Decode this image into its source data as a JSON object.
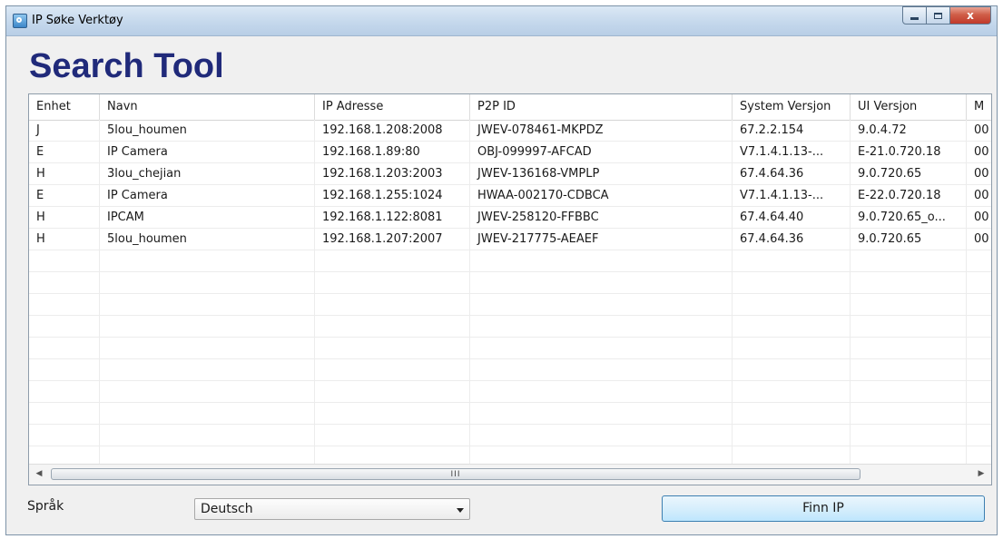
{
  "window": {
    "title": "IP Søke Verktøy",
    "close_glyph": "x"
  },
  "heading": "Search Tool",
  "table": {
    "columns": [
      "Enhet",
      "Navn",
      "IP Adresse",
      "P2P ID",
      "System Versjon",
      "UI Versjon",
      "M"
    ],
    "rows": [
      [
        "J",
        "5lou_houmen",
        "192.168.1.208:2008",
        "JWEV-078461-MKPDZ",
        "67.2.2.154",
        "9.0.4.72",
        "00"
      ],
      [
        "E",
        "IP Camera",
        "192.168.1.89:80",
        "OBJ-099997-AFCAD",
        "V7.1.4.1.13-...",
        "E-21.0.720.18",
        "00"
      ],
      [
        "H",
        "3lou_chejian",
        "192.168.1.203:2003",
        "JWEV-136168-VMPLP",
        "67.4.64.36",
        "9.0.720.65",
        "00"
      ],
      [
        "E",
        "IP Camera",
        "192.168.1.255:1024",
        "HWAA-002170-CDBCA",
        "V7.1.4.1.13-...",
        "E-22.0.720.18",
        "00"
      ],
      [
        "H",
        "IPCAM",
        "192.168.1.122:8081",
        "JWEV-258120-FFBBC",
        "67.4.64.40",
        "9.0.720.65_o...",
        "00"
      ],
      [
        "H",
        "5lou_houmen",
        "192.168.1.207:2007",
        "JWEV-217775-AEAEF",
        "67.4.64.36",
        "9.0.720.65",
        "00"
      ],
      [
        "",
        "",
        "",
        "",
        "",
        "",
        ""
      ],
      [
        "",
        "",
        "",
        "",
        "",
        "",
        ""
      ],
      [
        "",
        "",
        "",
        "",
        "",
        "",
        ""
      ],
      [
        "",
        "",
        "",
        "",
        "",
        "",
        ""
      ],
      [
        "",
        "",
        "",
        "",
        "",
        "",
        ""
      ],
      [
        "",
        "",
        "",
        "",
        "",
        "",
        ""
      ],
      [
        "",
        "",
        "",
        "",
        "",
        "",
        ""
      ],
      [
        "",
        "",
        "",
        "",
        "",
        "",
        ""
      ],
      [
        "",
        "",
        "",
        "",
        "",
        "",
        ""
      ],
      [
        "",
        "",
        "",
        "",
        "",
        "",
        ""
      ]
    ],
    "scrollbar_grip": "III"
  },
  "footer": {
    "language_label": "Språk",
    "language_value": "Deutsch",
    "find_button": "Finn IP"
  },
  "colors": {
    "heading": "#202a7a",
    "button_border": "#3c7fb1",
    "close": "#c0392b"
  },
  "icons": [
    "app-icon",
    "minimize-icon",
    "maximize-icon",
    "close-icon",
    "scroll-left-icon",
    "scroll-right-icon",
    "dropdown-arrow-icon"
  ]
}
